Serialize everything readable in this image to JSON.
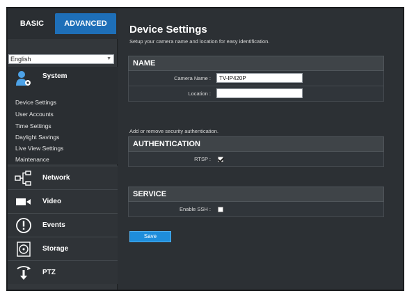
{
  "mode_tabs": {
    "basic": "BASIC",
    "advanced": "ADVANCED"
  },
  "language": {
    "selected": "English"
  },
  "sidebar": {
    "system": {
      "label": "System",
      "items": [
        "Device Settings",
        "User Accounts",
        "Time Settings",
        "Daylight Savings",
        "Live View Settings",
        "Maintenance"
      ]
    },
    "nav": [
      {
        "label": "Network",
        "icon": "network-icon"
      },
      {
        "label": "Video",
        "icon": "video-camera-icon"
      },
      {
        "label": "Events",
        "icon": "alert-icon"
      },
      {
        "label": "Storage",
        "icon": "storage-disk-icon"
      },
      {
        "label": "PTZ",
        "icon": "ptz-arrows-icon"
      }
    ]
  },
  "main": {
    "title": "Device Settings",
    "subtitle": "Setup your camera name and location for easy identification.",
    "name_section": {
      "header": "NAME",
      "camera_name_label": "Camera Name :",
      "camera_name_value": "TV-IP420P",
      "location_label": "Location :",
      "location_value": ""
    },
    "auth_note": "Add or remove security authentication.",
    "auth_section": {
      "header": "AUTHENTICATION",
      "rtsp_label": "RTSP :",
      "rtsp_checked": true
    },
    "service_section": {
      "header": "SERVICE",
      "ssh_label": "Enable SSH :",
      "ssh_checked": false
    },
    "save_label": "Save"
  },
  "colors": {
    "accent": "#1e6fb8",
    "save_button": "#1e8ddb",
    "background": "#2c3034"
  }
}
